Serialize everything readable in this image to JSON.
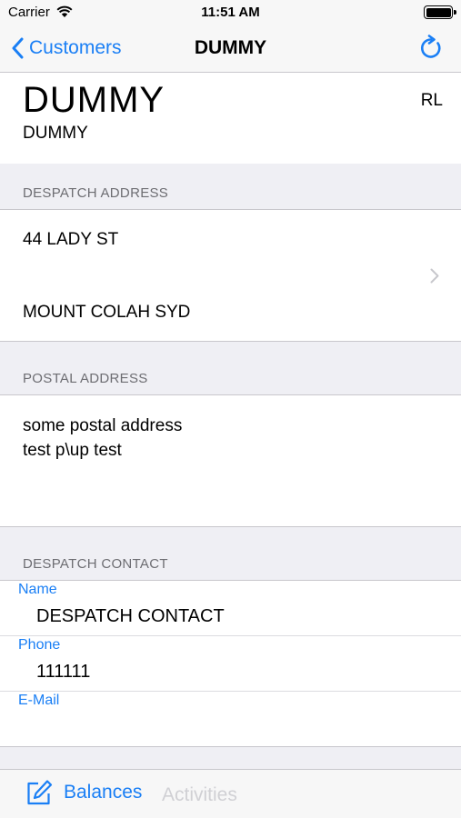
{
  "status_bar": {
    "carrier": "Carrier",
    "time": "11:51 AM"
  },
  "nav": {
    "back_label": "Customers",
    "title": "DUMMY"
  },
  "customer": {
    "name": "DUMMY",
    "subtitle": "DUMMY",
    "code": "RL"
  },
  "despatch_address": {
    "header": "DESPATCH ADDRESS",
    "line1": "44 LADY ST",
    "line2": "MOUNT COLAH SYD"
  },
  "postal_address": {
    "header": "POSTAL ADDRESS",
    "line1": "some postal address",
    "line2": "test p\\up test"
  },
  "despatch_contact": {
    "header": "DESPATCH CONTACT",
    "name_label": "Name",
    "name_value": "DESPATCH CONTACT",
    "phone_label": "Phone",
    "phone_value": "111111",
    "email_label": "E-Mail",
    "email_value": ""
  },
  "tabs": {
    "balances": "Balances",
    "activities": "Activities"
  },
  "colors": {
    "accent": "#1a7ff5",
    "background": "#efeff4",
    "separator": "#c8c7cc",
    "section_text": "#6d6d72",
    "disabled_tab": "#d0d0d4"
  }
}
